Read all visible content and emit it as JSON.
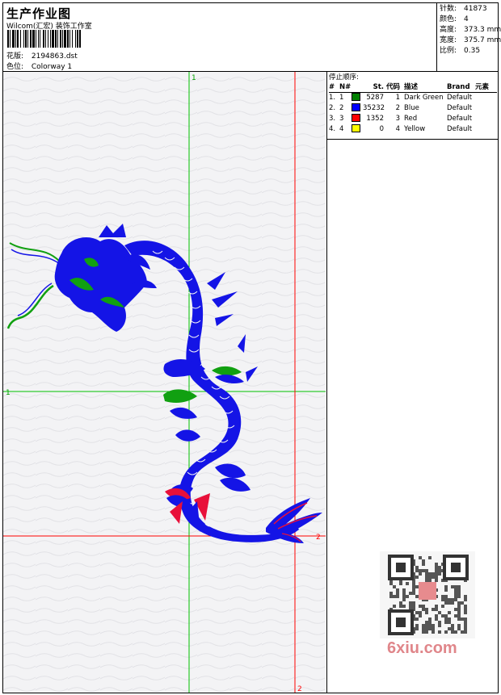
{
  "header": {
    "title": "生产作业图",
    "subtitle": "Wilcom(汇宏) 装饰工作室",
    "design_label": "花版:",
    "design_value": "2194863.dst",
    "colorway_label": "色位:",
    "colorway_value": "Colorway 1"
  },
  "stats": [
    {
      "label": "针数:",
      "value": "41873"
    },
    {
      "label": "颜色:",
      "value": "4"
    },
    {
      "label": "高度:",
      "value": "373.3 mm"
    },
    {
      "label": "宽度:",
      "value": "375.7 mm"
    },
    {
      "label": "比例:",
      "value": "0.35"
    }
  ],
  "sequence": {
    "title": "停止顺序:",
    "headers": [
      "#",
      "N#",
      "St.",
      "代码",
      "描述",
      "Brand",
      "元素"
    ],
    "rows": [
      {
        "idx": "1.",
        "n": "1",
        "color": "#008000",
        "stitches": "5287",
        "code": "1",
        "desc": "Dark Green",
        "brand": "Default"
      },
      {
        "idx": "2.",
        "n": "2",
        "color": "#0000ff",
        "stitches": "35232",
        "code": "2",
        "desc": "Blue",
        "brand": "Default"
      },
      {
        "idx": "3.",
        "n": "3",
        "color": "#ff0000",
        "stitches": "1352",
        "code": "3",
        "desc": "Red",
        "brand": "Default"
      },
      {
        "idx": "4.",
        "n": "4",
        "color": "#ffff00",
        "stitches": "0",
        "code": "4",
        "desc": "Yellow",
        "brand": "Default"
      }
    ]
  },
  "guides": {
    "green_label": "1",
    "red_label": "2"
  },
  "watermark": {
    "text": "6xiu.com"
  },
  "colors": {
    "green_guide": "#00c000",
    "red_guide": "#ff0000",
    "dragon_blue": "#1414e6",
    "dragon_green": "#11a011",
    "dragon_red": "#e8103a"
  }
}
